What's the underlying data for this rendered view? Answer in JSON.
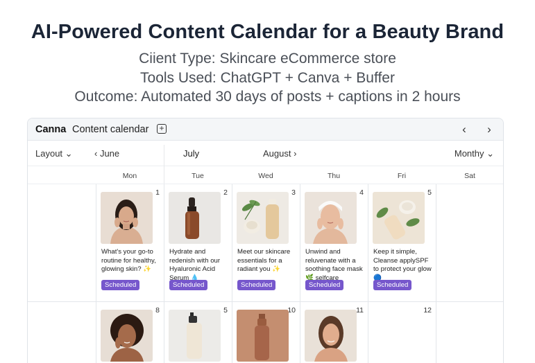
{
  "hero": {
    "title": "AI-Powered Content Calendar for a Beauty Brand",
    "line1": "Ciient Type: Skincare eCommerce store",
    "line2": "Tools Used: ChatGPT + Canva + Buffer",
    "line3": "Outcome: Automated 30 days of posts + captions in 2 hours"
  },
  "app": {
    "brand": "Canna",
    "title": "Content calendar",
    "add_icon": "plus-square-icon",
    "prev_icon": "chevron-left-icon",
    "next_icon": "chevron-right-icon"
  },
  "toolbar": {
    "layout_label": "Layout ⌄",
    "prev_month": "‹  June",
    "current_month": "July",
    "next_month": "August ›",
    "view_label": "Monthy ⌄"
  },
  "days": [
    "Mon",
    "Tue",
    "Wed",
    "Thu",
    "Fri",
    "Sat"
  ],
  "colors": {
    "badge": "#7657cc",
    "border": "#e3e6ea"
  },
  "week1": [
    {
      "date": "",
      "caption": "",
      "status": ""
    },
    {
      "date": "1",
      "caption": "What's your go-to routine for healthy, glowing skin? ✨",
      "status": "Scheduled",
      "image": "woman-portrait-dark-hair"
    },
    {
      "date": "2",
      "caption": "Hydrate and redenish with our Hyaluronic Acid Serum 💧",
      "status": "Scheduled",
      "image": "amber-dropper-bottle"
    },
    {
      "date": "3",
      "caption": "Meet our skincare essentials for a radiant you ✨",
      "status": "Scheduled",
      "image": "cream-jar-and-bottle-with-leaves"
    },
    {
      "date": "4",
      "caption": "Unwind and reluvenate with a soothing face mask 🌿 selfcare",
      "status": "Scheduled",
      "image": "woman-with-headband"
    },
    {
      "date": "5",
      "caption": "Keep it simple, Cleanse applySPF to protect your glow 🔵",
      "status": "Scheduled",
      "image": "cream-tube-with-leaves"
    }
  ],
  "week2": [
    {
      "date": ""
    },
    {
      "date": "8",
      "image": "woman-curly-hair"
    },
    {
      "date": "5",
      "image": "white-pump-bottle"
    },
    {
      "date": "10",
      "image": "terracotta-bottle"
    },
    {
      "date": "11",
      "image": "woman-portrait-smiling"
    },
    {
      "date": "12"
    }
  ]
}
